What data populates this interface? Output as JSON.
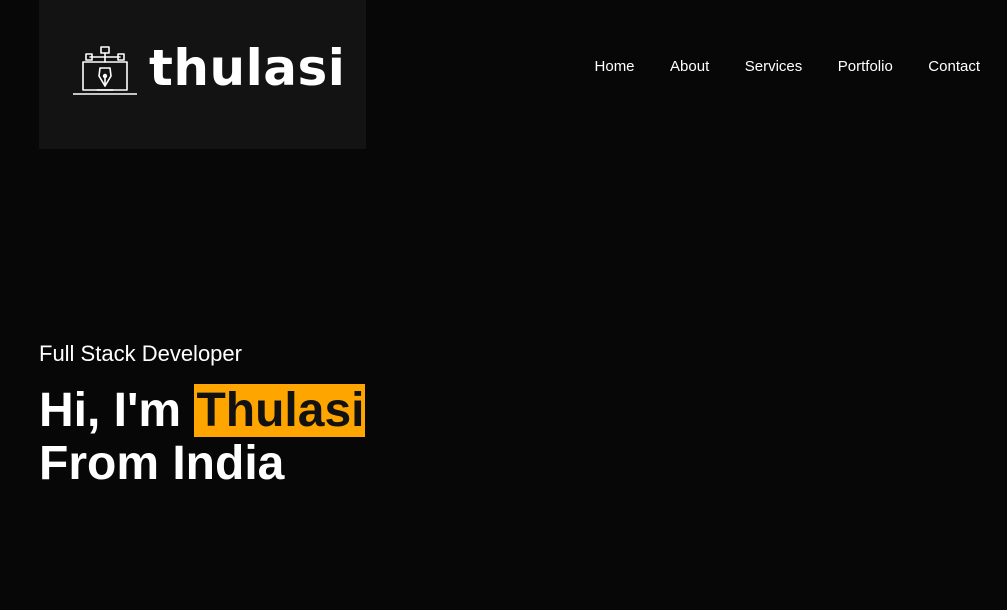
{
  "header": {
    "logo_text": "thulasi",
    "logo_icon": "pen-tool-laptop-icon"
  },
  "nav": {
    "items": [
      {
        "label": "Home"
      },
      {
        "label": "About"
      },
      {
        "label": "Services"
      },
      {
        "label": "Portfolio"
      },
      {
        "label": "Contact"
      }
    ]
  },
  "hero": {
    "subtitle": "Full Stack Developer",
    "greeting": "Hi, I'm",
    "name": "Thulasi",
    "origin": "From India"
  },
  "colors": {
    "background": "#070707",
    "logo_panel": "#131313",
    "accent": "#ffa500",
    "text": "#ffffff"
  }
}
